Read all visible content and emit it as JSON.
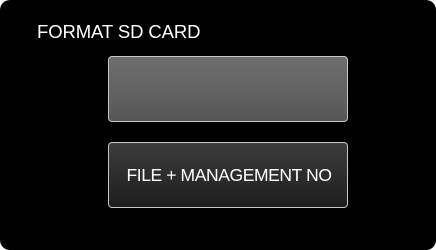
{
  "screen": {
    "title": "FORMAT SD CARD"
  },
  "options": {
    "top": {
      "label": "",
      "state": "selected"
    },
    "bottom": {
      "label": "FILE + MANAGEMENT NO"
    }
  },
  "colors": {
    "background": "#000000",
    "text": "#ffffff",
    "button_border": "#c8c8c8",
    "selected_button": "#666666",
    "unselected_button": "#2e2e2e"
  }
}
